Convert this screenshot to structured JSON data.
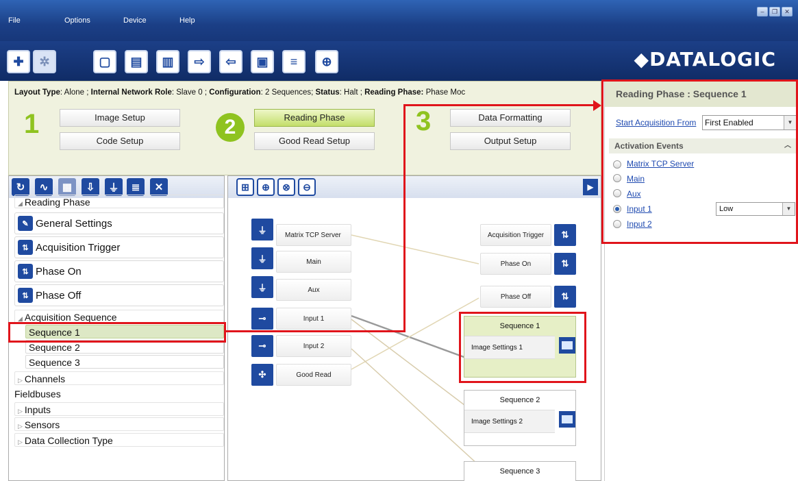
{
  "menu": {
    "file": "File",
    "options": "Options",
    "device": "Device",
    "help": "Help"
  },
  "window_controls": {
    "minimize": "–",
    "restore": "❐",
    "close": "✕"
  },
  "brand": "◆DATALOGIC",
  "status": {
    "layout_type_label": "Layout Type",
    "layout_type_value": ": Alone ; ",
    "network_role_label": "Internal Network Role",
    "network_role_value": ": Slave 0 ; ",
    "configuration_label": "Configuration",
    "configuration_value": ": 2 Sequences; ",
    "status_label": "Status",
    "status_value": ": Halt ; ",
    "reading_phase_label": "Reading Phase:",
    "reading_phase_value": " Phase Moc"
  },
  "steps": {
    "step1": "1",
    "step2": "2",
    "step3": "3",
    "image_setup": "Image Setup",
    "code_setup": "Code Setup",
    "reading_phase": "Reading Phase",
    "good_read_setup": "Good Read Setup",
    "data_formatting": "Data Formatting",
    "output_setup": "Output Setup"
  },
  "tree": {
    "reading_phase": "Reading Phase",
    "general_settings": "General Settings",
    "acquisition_trigger": "Acquisition Trigger",
    "phase_on": "Phase On",
    "phase_off": "Phase Off",
    "acquisition_sequence": "Acquisition Sequence",
    "sequence1": "Sequence 1",
    "sequence2": "Sequence 2",
    "sequence3": "Sequence 3",
    "channels": "Channels",
    "fieldbuses": "Fieldbuses",
    "inputs": "Inputs",
    "sensors": "Sensors",
    "data_collection_type": "Data Collection Type"
  },
  "graph": {
    "sources": [
      "Matrix TCP Server",
      "Main",
      "Aux",
      "Input 1",
      "Input 2",
      "Good Read"
    ],
    "targets": [
      "Acquisition Trigger",
      "Phase On",
      "Phase Off"
    ],
    "sequences": [
      {
        "title": "Sequence  1",
        "image": "Image Settings  1"
      },
      {
        "title": "Sequence  2",
        "image": "Image Settings  2"
      },
      {
        "title": "Sequence  3",
        "image": ""
      }
    ]
  },
  "right_panel": {
    "title": "Reading Phase :  Sequence 1",
    "start_acq_label": "Start Acquisition From",
    "start_acq_value": "First Enabled",
    "activation_events": "Activation Events",
    "events": [
      "Matrix TCP Server",
      "Main",
      "Aux",
      "Input 1",
      "Input 2"
    ],
    "input1_level": "Low"
  },
  "colors": {
    "accent": "#1f4aa0",
    "highlight": "#e0141b",
    "step_green": "#8fc320"
  }
}
